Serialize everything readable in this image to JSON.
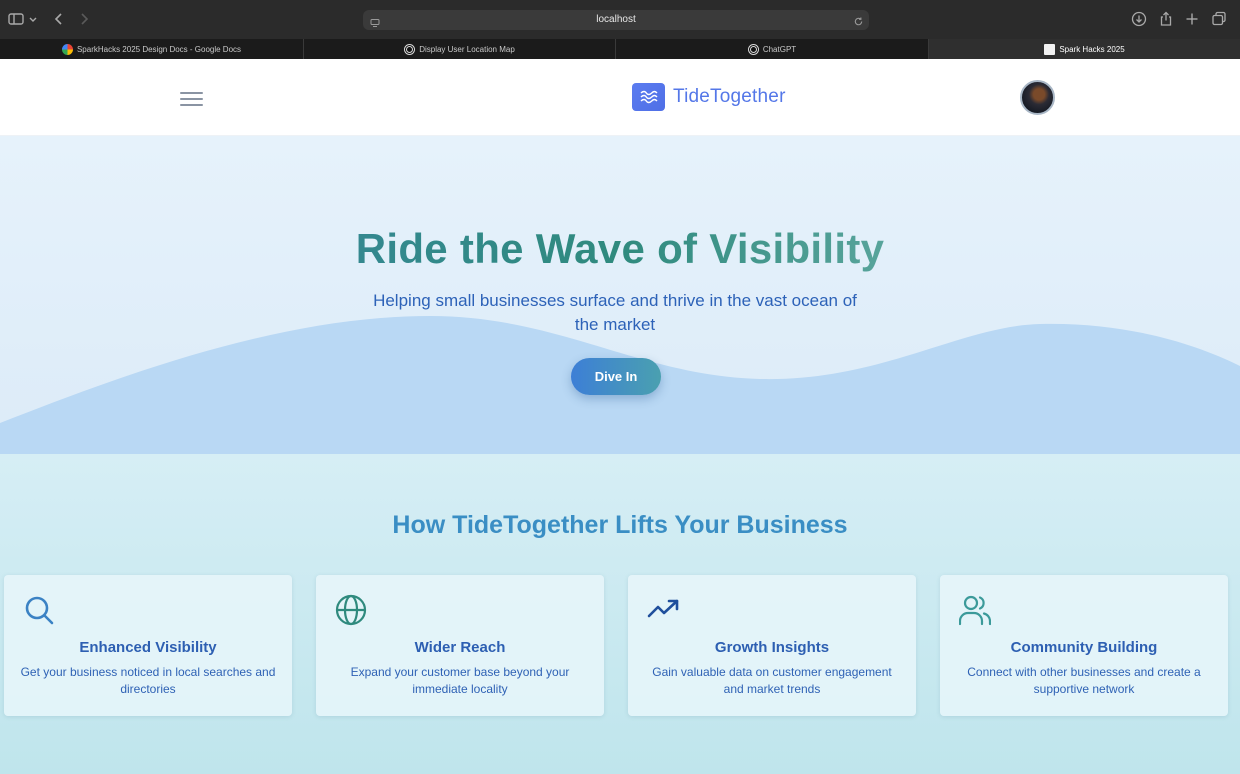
{
  "browser": {
    "url": "localhost",
    "tabs": [
      {
        "label": "SparkHacks 2025 Design Docs - Google Docs",
        "favicon": "google-icon"
      },
      {
        "label": "Display User Location Map",
        "favicon": "chatgpt-icon"
      },
      {
        "label": "ChatGPT",
        "favicon": "chatgpt-icon"
      },
      {
        "label": "Spark Hacks 2025",
        "favicon": "page-icon"
      }
    ],
    "active_tab": 3
  },
  "header": {
    "logo_text": "TideTogether",
    "logo_icon": "waves-icon",
    "menu_icon": "hamburger-icon"
  },
  "hero": {
    "title": "Ride the Wave of Visibility",
    "subtitle": "Helping small businesses surface and thrive in the vast ocean of the market",
    "cta_label": "Dive In"
  },
  "features": {
    "title": "How TideTogether Lifts Your Business",
    "cards": [
      {
        "icon": "search-icon",
        "title": "Enhanced Visibility",
        "description": "Get your business noticed in local searches and directories",
        "icon_color": "#3b82c4"
      },
      {
        "icon": "globe-icon",
        "title": "Wider Reach",
        "description": "Expand your customer base beyond your immediate locality",
        "icon_color": "#2f8a7e"
      },
      {
        "icon": "trending-up-icon",
        "title": "Growth Insights",
        "description": "Gain valuable data on customer engagement and market trends",
        "icon_color": "#1f4f9c"
      },
      {
        "icon": "users-icon",
        "title": "Community Building",
        "description": "Connect with other businesses and create a supportive network",
        "icon_color": "#3b9a9a"
      }
    ]
  },
  "colors": {
    "brand": "#5477e8",
    "heading_teal": "#2f8a7e",
    "body_blue": "#2d62b8",
    "features_title": "#3a8ec4"
  }
}
